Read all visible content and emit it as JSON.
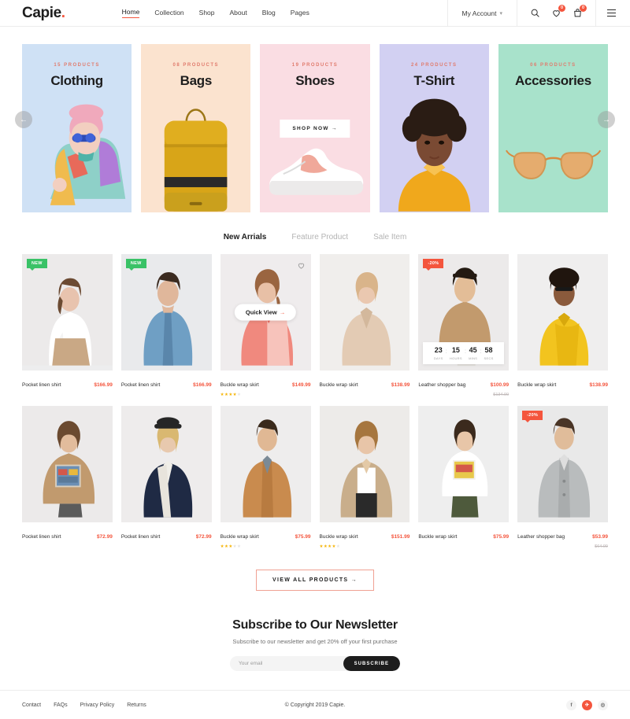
{
  "header": {
    "brand": "Capie",
    "brand_dot": ".",
    "nav": [
      {
        "label": "Home",
        "active": true
      },
      {
        "label": "Collection",
        "active": false
      },
      {
        "label": "Shop",
        "active": false
      },
      {
        "label": "About",
        "active": false
      },
      {
        "label": "Blog",
        "active": false
      },
      {
        "label": "Pages",
        "active": false
      }
    ],
    "account_label": "My Account",
    "icons": {
      "search": "search-icon",
      "wishlist": "heart-icon",
      "wishlist_count": "0",
      "cart": "cart-icon",
      "cart_count": "0",
      "menu": "hamburger-icon"
    }
  },
  "categories": {
    "prev_label": "←",
    "next_label": "→",
    "shop_now_label": "SHOP NOW",
    "shop_now_arrow": "→",
    "items": [
      {
        "count": "15 PRODUCTS",
        "title": "Clothing",
        "bg": "#cfe1f5",
        "accent": "#e0796b"
      },
      {
        "count": "08 PRODUCTS",
        "title": "Bags",
        "bg": "#fbe3cf",
        "accent": "#e0796b"
      },
      {
        "count": "19 PRODUCTS",
        "title": "Shoes",
        "bg": "#fadde3",
        "accent": "#e0796b"
      },
      {
        "count": "24 PRODUCTS",
        "title": "T-Shirt",
        "bg": "#d2d0f2",
        "accent": "#e0796b"
      },
      {
        "count": "06 PRODUCTS",
        "title": "Accessories",
        "bg": "#a8e2cb",
        "accent": "#e0796b"
      }
    ]
  },
  "tabs": [
    {
      "label": "New Arrials",
      "active": true
    },
    {
      "label": "Feature Product",
      "active": false
    },
    {
      "label": "Sale Item",
      "active": false
    }
  ],
  "quick_view": {
    "label": "Quick View",
    "arrow": "→"
  },
  "countdown": {
    "days": "23",
    "days_label": "DAYS",
    "hours": "15",
    "hours_label": "HOURS",
    "mins": "45",
    "mins_label": "MINS",
    "secs": "58",
    "secs_label": "SECS",
    "sep": ":"
  },
  "products": [
    {
      "name": "Pocket linen shirt",
      "price": "$166.99",
      "old_price": "",
      "badge": "NEW",
      "badge_type": "new",
      "rating": 0,
      "bg": "#ededee",
      "subject": "woman-white-top"
    },
    {
      "name": "Pocket linen shirt",
      "price": "$166.99",
      "old_price": "",
      "badge": "NEW",
      "badge_type": "new",
      "rating": 0,
      "bg": "#e9eaec",
      "subject": "man-denim-shirt"
    },
    {
      "name": "Buckle wrap skirt",
      "price": "$149.99",
      "old_price": "",
      "badge": "",
      "badge_type": "",
      "rating": 4,
      "bg": "#efeced",
      "subject": "woman-red-blouse"
    },
    {
      "name": "Buckle wrap skirt",
      "price": "$138.99",
      "old_price": "",
      "badge": "",
      "badge_type": "",
      "rating": 0,
      "bg": "#f0eeec",
      "subject": "woman-beige-blouse"
    },
    {
      "name": "Leather shopper bag",
      "price": "$100.99",
      "old_price": "$134.99",
      "badge": "-20%",
      "badge_type": "off",
      "rating": 0,
      "bg": "#eceaea",
      "subject": "man-tan-tee"
    },
    {
      "name": "Buckle wrap skirt",
      "price": "$138.99",
      "old_price": "",
      "badge": "",
      "badge_type": "",
      "rating": 0,
      "bg": "#efeeee",
      "subject": "woman-yellow-top"
    },
    {
      "name": "Pocket linen shirt",
      "price": "$72.99",
      "old_price": "",
      "badge": "",
      "badge_type": "",
      "rating": 0,
      "bg": "#eceaea",
      "subject": "woman-graphic-tee"
    },
    {
      "name": "Pocket linen shirt",
      "price": "$72.99",
      "old_price": "",
      "badge": "",
      "badge_type": "",
      "rating": 0,
      "bg": "#eeecec",
      "subject": "woman-navy-blazer"
    },
    {
      "name": "Buckle wrap skirt",
      "price": "$75.99",
      "old_price": "",
      "badge": "",
      "badge_type": "",
      "rating": 3,
      "bg": "#eeeded",
      "subject": "man-camel-coat"
    },
    {
      "name": "Buckle wrap skirt",
      "price": "$151.99",
      "old_price": "",
      "badge": "",
      "badge_type": "",
      "rating": 4,
      "bg": "#edebe9",
      "subject": "woman-trench-coat"
    },
    {
      "name": "Buckle wrap skirt",
      "price": "$75.99",
      "old_price": "",
      "badge": "",
      "badge_type": "",
      "rating": 0,
      "bg": "#eeeeee",
      "subject": "woman-white-tee"
    },
    {
      "name": "Leather shopper bag",
      "price": "$53.99",
      "old_price": "$64.99",
      "badge": "-20%",
      "badge_type": "off",
      "rating": 0,
      "bg": "#e9e9e9",
      "subject": "man-grey-coat"
    }
  ],
  "view_all": {
    "label": "VIEW ALL PRODUCTS",
    "arrow": "→"
  },
  "newsletter": {
    "title": "Subscribe to Our Newsletter",
    "subtitle": "Subscribe to our newsletter and get 20% off your first purchase",
    "placeholder": "Your email",
    "value": "",
    "button": "SUBSCRIBE"
  },
  "footer": {
    "links": [
      "Contact",
      "FAQs",
      "Privacy Policy",
      "Returns"
    ],
    "copyright": "© Copyright 2019 Capie.",
    "socials": [
      {
        "name": "facebook-icon",
        "glyph": "f",
        "style": "plain"
      },
      {
        "name": "twitter-icon",
        "glyph": "✈",
        "style": "tw"
      },
      {
        "name": "instagram-icon",
        "glyph": "◎",
        "style": "plain"
      }
    ]
  },
  "colors": {
    "accent": "#f4553d",
    "new": "#3ac267",
    "star": "#f5b50a",
    "text": "#1d1d1d"
  }
}
